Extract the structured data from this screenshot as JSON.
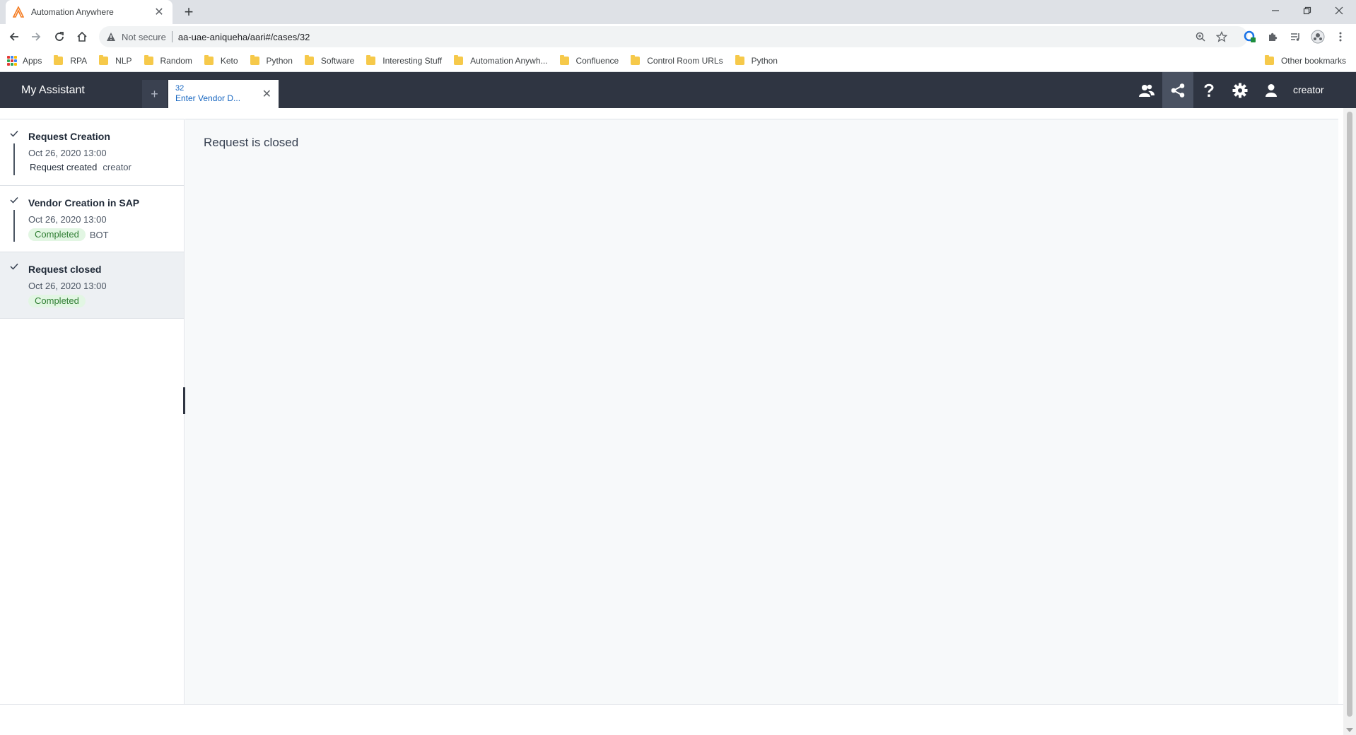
{
  "browser": {
    "tab_title": "Automation Anywhere",
    "address_warning": "Not secure",
    "url": "aa-uae-aniqueha/aari#/cases/32",
    "bookmarks": [
      {
        "label": "Apps",
        "type": "apps"
      },
      {
        "label": "RPA",
        "type": "folder"
      },
      {
        "label": "NLP",
        "type": "folder"
      },
      {
        "label": "Random",
        "type": "folder"
      },
      {
        "label": "Keto",
        "type": "folder"
      },
      {
        "label": "Python",
        "type": "folder"
      },
      {
        "label": "Software",
        "type": "folder"
      },
      {
        "label": "Interesting Stuff",
        "type": "folder"
      },
      {
        "label": "Automation Anywh...",
        "type": "folder"
      },
      {
        "label": "Confluence",
        "type": "folder"
      },
      {
        "label": "Control Room URLs",
        "type": "folder"
      },
      {
        "label": "Python",
        "type": "folder"
      }
    ],
    "other_bookmarks": "Other bookmarks"
  },
  "app": {
    "title": "My Assistant",
    "add_case_symbol": "+",
    "case_tab": {
      "id": "32",
      "name": "Enter Vendor D..."
    },
    "user": "creator",
    "header_icons": [
      "team-icon",
      "share-icon",
      "help-icon",
      "gear-icon",
      "user-icon"
    ],
    "active_icon": "share-icon"
  },
  "timeline": [
    {
      "title": "Request Creation",
      "date": "Oct 26, 2020 13:00",
      "status": "Request created",
      "status_style": "plain",
      "actor": "creator",
      "selected": false
    },
    {
      "title": "Vendor Creation in SAP",
      "date": "Oct 26, 2020 13:00",
      "status": "Completed",
      "status_style": "badge",
      "actor": "BOT",
      "selected": false
    },
    {
      "title": "Request closed",
      "date": "Oct 26, 2020 13:00",
      "status": "Completed",
      "status_style": "badge",
      "actor": "",
      "selected": true
    }
  ],
  "main": {
    "message": "Request is closed"
  },
  "colors": {
    "header_bg": "#2f3542",
    "badge_bg": "#e2f6e3",
    "badge_text": "#2e7d32",
    "link": "#1565c0"
  }
}
